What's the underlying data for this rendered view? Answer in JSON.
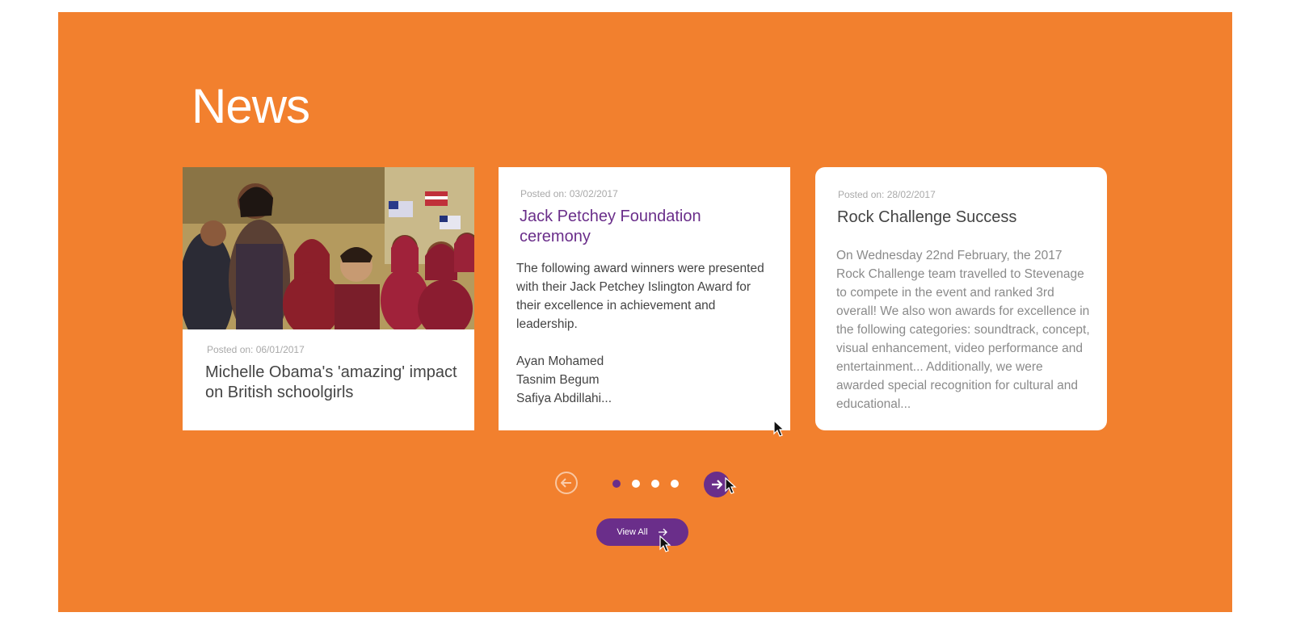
{
  "section": {
    "title": "News"
  },
  "cards": [
    {
      "date": "Posted on: 06/01/2017",
      "title": "Michelle Obama's 'amazing' impact on British schoolgirls",
      "image": "group-photo"
    },
    {
      "date": "Posted on: 03/02/2017",
      "title": "Jack Petchey Foundation ceremony",
      "body": "The following award winners were presented with their Jack Petchey Islington Award for their excellence in achievement and leadership.",
      "names": [
        "Ayan Mohamed",
        "Tasnim Begum",
        "Safiya Abdillahi..."
      ]
    },
    {
      "date": "Posted on: 28/02/2017",
      "title": "Rock Challenge Success",
      "body": "On Wednesday 22nd February, the 2017 Rock Challenge team travelled to Stevenage to compete in the event and ranked 3rd overall! We also won awards for excellence in the following categories:  soundtrack, concept, visual enhancement, video performance and entertainment... Additionally, we were awarded special recognition for cultural and educational..."
    }
  ],
  "carousel": {
    "total_pages": 4,
    "active_page": 1,
    "prev_icon": "arrow-left-icon",
    "next_icon": "arrow-right-icon"
  },
  "view_all": {
    "label": "View All",
    "icon": "arrow-right-icon"
  },
  "colors": {
    "panel": "#f2802e",
    "accent": "#6a2e8a",
    "card": "#ffffff"
  }
}
